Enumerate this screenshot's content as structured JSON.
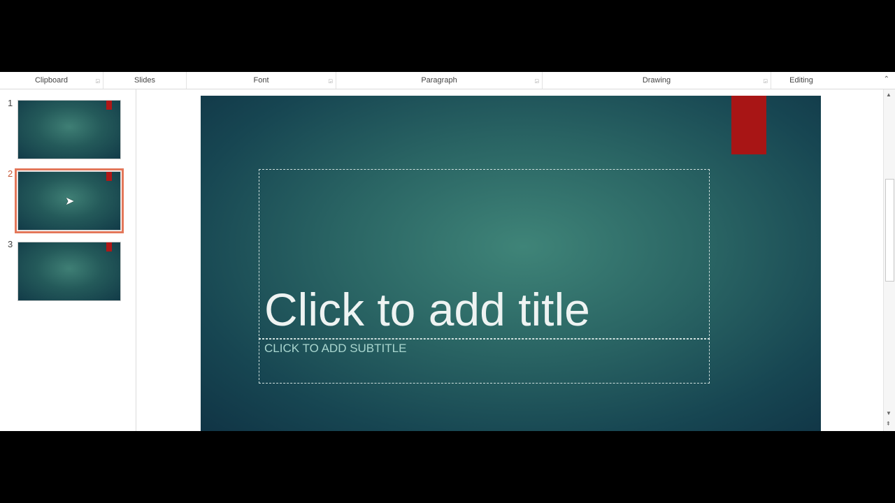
{
  "ribbon": {
    "groups": [
      "Clipboard",
      "Slides",
      "Font",
      "Paragraph",
      "Drawing",
      "Editing"
    ]
  },
  "thumbnails": [
    {
      "number": "1"
    },
    {
      "number": "2",
      "selected": true
    },
    {
      "number": "3"
    }
  ],
  "slide": {
    "title_placeholder": "Click to add title",
    "subtitle_placeholder": "CLICK TO ADD SUBTITLE"
  },
  "colors": {
    "accent_red": "#a81515",
    "selection": "#e3775a",
    "background": "#2a6564"
  }
}
